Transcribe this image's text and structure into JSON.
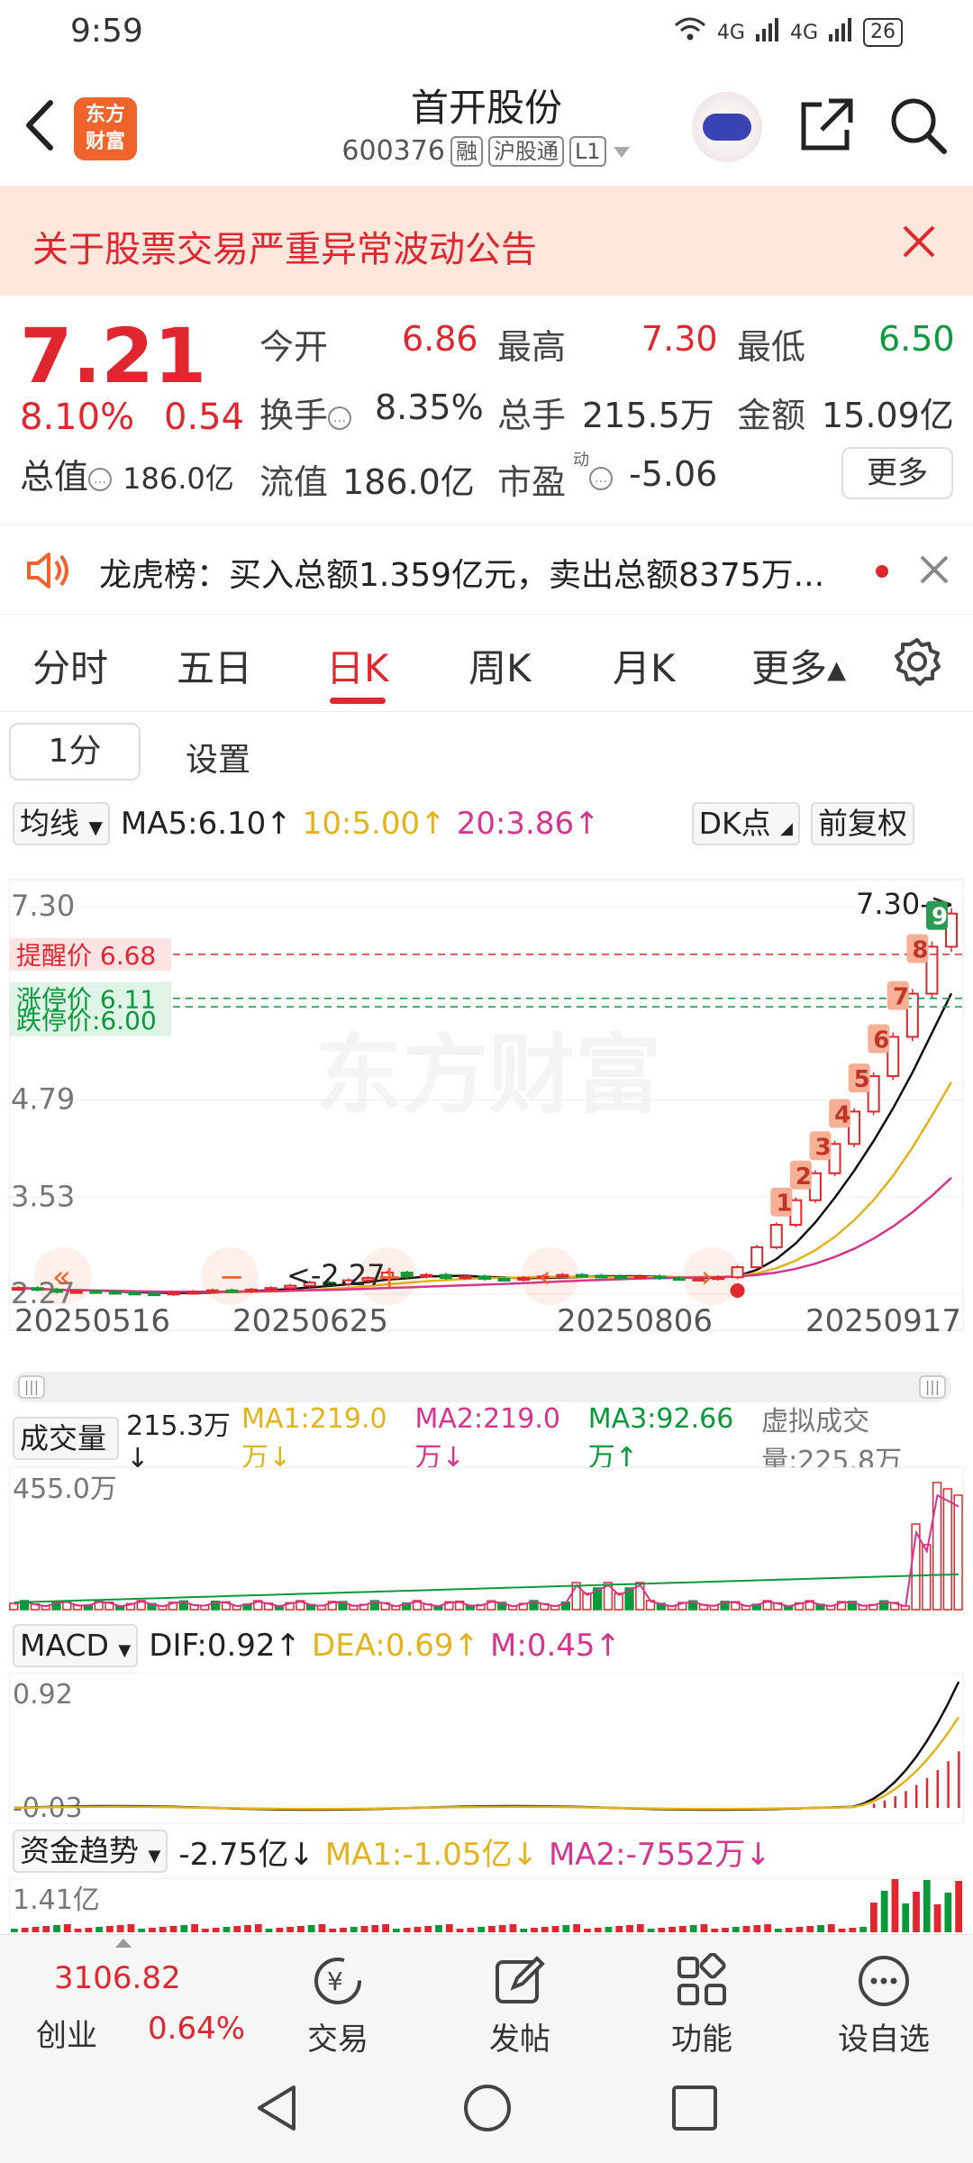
{
  "status": {
    "time": "9:59",
    "signal1": "4G",
    "signal2": "4G",
    "battery": "26"
  },
  "header": {
    "title": "首开股份",
    "code": "600376",
    "tag_margin": "融",
    "tag_connect": "沪股通",
    "tag_level": "L1",
    "logo_line1": "东方",
    "logo_line2": "财富"
  },
  "notice": {
    "text": "关于股票交易严重异常波动公告"
  },
  "quote": {
    "price": "7.21",
    "change_pct": "8.10%",
    "change_amt": "0.54",
    "open_label": "今开",
    "open": "6.86",
    "high_label": "最高",
    "high": "7.30",
    "low_label": "最低",
    "low": "6.50",
    "turnover_label": "换手",
    "turnover": "8.35%",
    "volume_label": "总手",
    "volume": "215.5万",
    "amount_label": "金额",
    "amount": "15.09亿",
    "total_mv_label": "总值",
    "total_mv": "186.0亿",
    "float_mv_label": "流值",
    "float_mv": "186.0亿",
    "pe_label": "市盈",
    "pe_sup": "动",
    "pe": "-5.06",
    "more": "更多"
  },
  "dragon": {
    "text": "龙虎榜：买入总额1.359亿元，卖出总额8375万..."
  },
  "tabs": [
    {
      "label": "分时"
    },
    {
      "label": "五日"
    },
    {
      "label": "日K"
    },
    {
      "label": "周K"
    },
    {
      "label": "月K"
    },
    {
      "label": "更多▴"
    }
  ],
  "period": {
    "button": "1分",
    "settings": "设置"
  },
  "ma": {
    "selector": "均线",
    "ma5": "MA5:6.10↑",
    "ma10": "10:5.00↑",
    "ma20": "20:3.86↑",
    "dk": "DK点",
    "adjust": "前复权"
  },
  "kchart": {
    "y_ticks": [
      "7.30",
      "4.79",
      "3.53",
      "2.27"
    ],
    "high_marker": "7.30->",
    "low_marker": "<-2.27",
    "alert1": "提醒价 6.68",
    "alert2": "涨停价 6.11",
    "alert3": "跌停价:6.00",
    "watermark": "东方财富",
    "dates": [
      "20250516",
      "20250625",
      "20250806",
      "20250917"
    ],
    "tail_labels": [
      "1",
      "2",
      "3",
      "4",
      "5",
      "6",
      "7",
      "8",
      "9"
    ],
    "colors": {
      "up": "#e0262f",
      "down": "#0a9a3c",
      "ma5": "#111111",
      "ma10": "#e5b21a",
      "ma20": "#d6348f"
    }
  },
  "chart_data": [
    {
      "type": "candlestick",
      "title": "日K",
      "ylim": [
        2.27,
        7.3
      ],
      "y_ticks": [
        7.3,
        4.79,
        3.53,
        2.27
      ],
      "x_ticks": [
        "20250516",
        "20250625",
        "20250806",
        "20250917"
      ],
      "series": [
        {
          "name": "close",
          "values": [
            2.35,
            2.33,
            2.3,
            2.31,
            2.3,
            2.29,
            2.28,
            2.27,
            2.29,
            2.3,
            2.32,
            2.31,
            2.33,
            2.35,
            2.38,
            2.42,
            2.4,
            2.45,
            2.48,
            2.55,
            2.5,
            2.52,
            2.48,
            2.5,
            2.47,
            2.46,
            2.48,
            2.5,
            2.52,
            2.51,
            2.5,
            2.49,
            2.5,
            2.48,
            2.47,
            2.47,
            2.49,
            2.62,
            2.88,
            3.17,
            3.49,
            3.84,
            4.22,
            4.64,
            5.1,
            5.61,
            6.17,
            6.78,
            7.21
          ]
        },
        {
          "name": "MA5",
          "values": [
            6.1
          ]
        },
        {
          "name": "MA10",
          "values": [
            5.0
          ]
        },
        {
          "name": "MA20",
          "values": [
            3.86
          ]
        }
      ]
    },
    {
      "type": "bar",
      "title": "成交量",
      "y_ticks": [
        "455.0万"
      ],
      "summary": {
        "volume": "215.3万",
        "MA1": "219.0万",
        "MA2": "219.0万",
        "MA3": "92.66万",
        "virtual": "225.8万"
      }
    },
    {
      "type": "line",
      "title": "MACD",
      "y_ticks": [
        0.92,
        -0.03
      ],
      "summary": {
        "DIF": 0.92,
        "DEA": 0.69,
        "M": 0.45
      }
    },
    {
      "type": "bar",
      "title": "资金趋势",
      "y_ticks": [
        "1.41亿"
      ],
      "summary": {
        "value": "-2.75亿",
        "MA1": "-1.05亿",
        "MA2": "-7552万"
      }
    }
  ],
  "volume": {
    "selector": "成交量",
    "v": "215.3万↓",
    "ma1": "MA1:219.0万↓",
    "ma2": "MA2:219.0万↓",
    "ma3": "MA3:92.66万↑",
    "virtual": "虚拟成交量:225.8万",
    "ytick": "455.0万"
  },
  "macd": {
    "selector": "MACD",
    "dif": "DIF:0.92↑",
    "dea": "DEA:0.69↑",
    "m": "M:0.45↑",
    "yt1": "0.92",
    "yt2": "-0.03"
  },
  "fund": {
    "selector": "资金趋势",
    "v": "-2.75亿↓",
    "ma1": "MA1:-1.05亿↓",
    "ma2": "MA2:-7552万↓",
    "ytick": "1.41亿"
  },
  "bottomnav": {
    "index_value": "3106.82",
    "index_name": "创业",
    "index_pct": "0.64%",
    "trade": "交易",
    "post": "发帖",
    "func": "功能",
    "watch": "设自选"
  }
}
